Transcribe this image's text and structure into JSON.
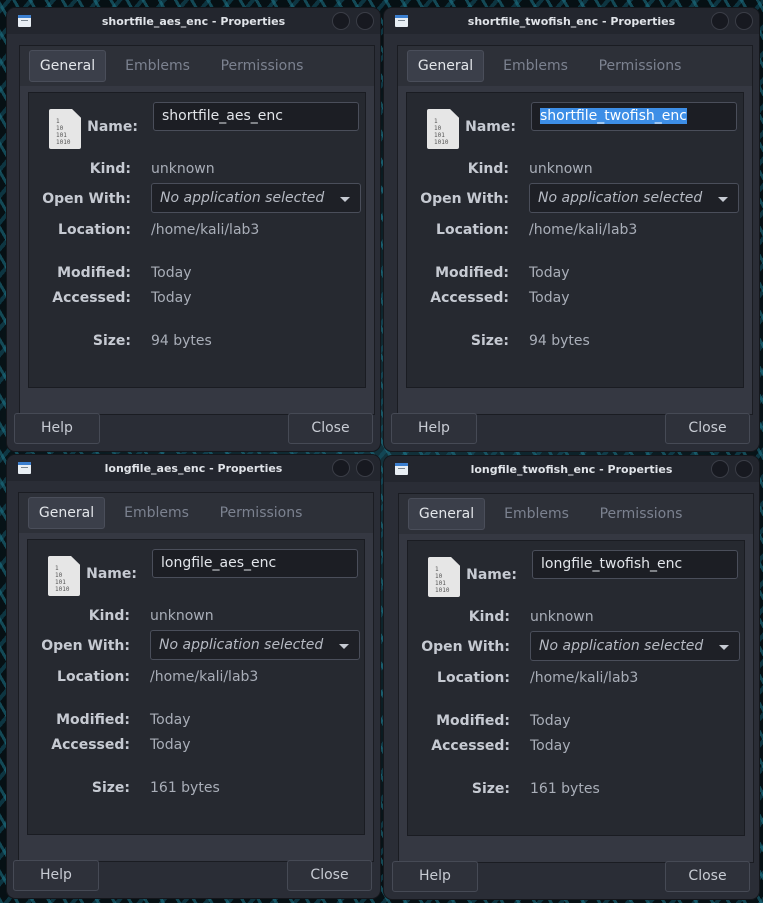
{
  "tabs": {
    "general": "General",
    "emblems": "Emblems",
    "permissions": "Permissions"
  },
  "labels": {
    "name": "Name:",
    "kind": "Kind:",
    "open_with": "Open With:",
    "location": "Location:",
    "modified": "Modified:",
    "accessed": "Accessed:",
    "size": "Size:"
  },
  "buttons": {
    "help": "Help",
    "close": "Close"
  },
  "windows": [
    {
      "title": "shortfile_aes_enc - Properties",
      "name": "shortfile_aes_enc",
      "name_selected": false,
      "kind": "unknown",
      "open_with": "No application selected",
      "location": "/home/kali/lab3",
      "modified": "Today",
      "accessed": "Today",
      "size": "94 bytes"
    },
    {
      "title": "shortfile_twofish_enc - Properties",
      "name": "shortfile_twofish_enc",
      "name_selected": true,
      "kind": "unknown",
      "open_with": "No application selected",
      "location": "/home/kali/lab3",
      "modified": "Today",
      "accessed": "Today",
      "size": "94 bytes"
    },
    {
      "title": "longfile_aes_enc - Properties",
      "name": "longfile_aes_enc",
      "name_selected": false,
      "kind": "unknown",
      "open_with": "No application selected",
      "location": "/home/kali/lab3",
      "modified": "Today",
      "accessed": "Today",
      "size": "161 bytes"
    },
    {
      "title": "longfile_twofish_enc - Properties",
      "name": "longfile_twofish_enc",
      "name_selected": false,
      "kind": "unknown",
      "open_with": "No application selected",
      "location": "/home/kali/lab3",
      "modified": "Today",
      "accessed": "Today",
      "size": "161 bytes"
    }
  ],
  "file_icon_glyph": [
    "1",
    "10",
    "101",
    "1010"
  ],
  "colors": {
    "selection": "#3d8ee6",
    "window_bg": "#2a2d36"
  }
}
